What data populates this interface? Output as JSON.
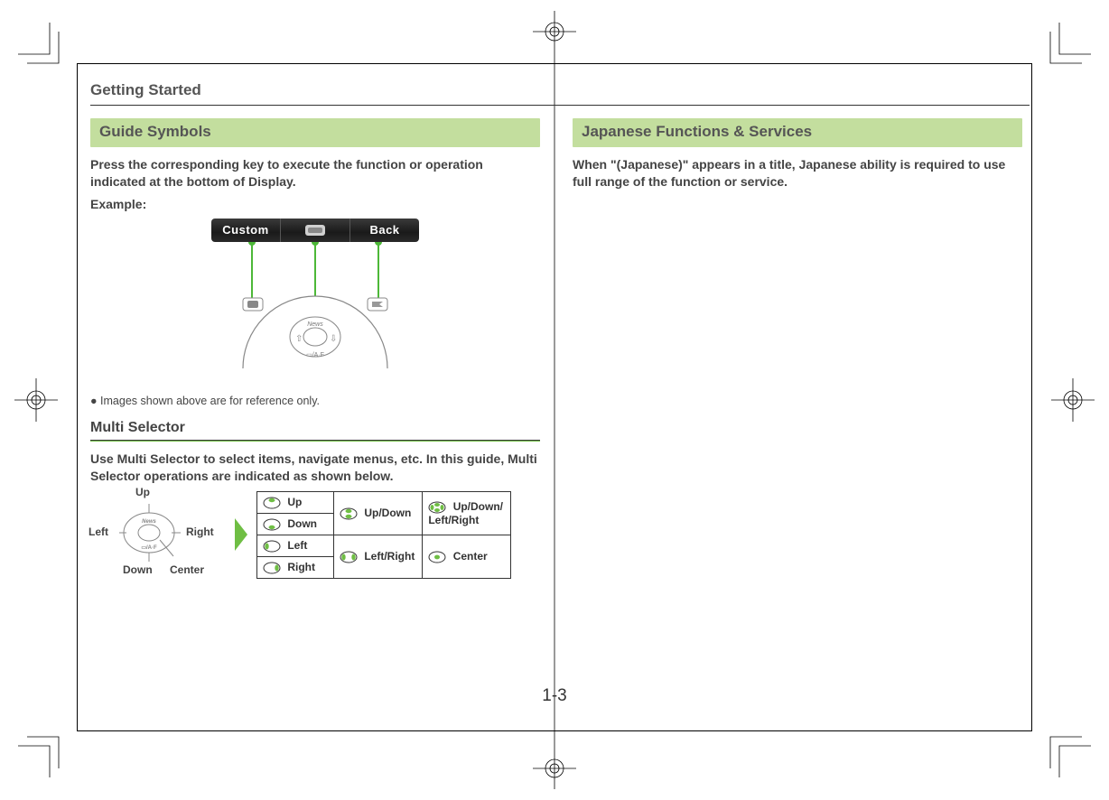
{
  "header": "Getting Started",
  "page_number": "1-3",
  "left": {
    "section1_title": "Guide Symbols",
    "intro1": "Press the corresponding key to execute the function or operation indicated at the bottom of Display.",
    "intro2": "Example:",
    "softkeys": {
      "left": "Custom",
      "right": "Back",
      "center_icon": "info-icon"
    },
    "note": "Images shown above are for reference only.",
    "subhead": "Multi Selector",
    "ms_desc": "Use Multi Selector to select items, navigate menus, etc. In this guide, Multi Selector operations are indicated as shown below.",
    "labels": {
      "up": "Up",
      "down": "Down",
      "left": "Left",
      "right": "Right",
      "center": "Center"
    },
    "table": {
      "r1c1": "Up",
      "r1c2": "Up/Down",
      "r1c3_line1": "Up/Down/",
      "r1c3_line2": "Left/Right",
      "r2c1": "Down",
      "r3c1": "Left",
      "r3c2": "Left/Right",
      "r3c3": "Center",
      "r4c1": "Right"
    }
  },
  "right": {
    "section_title": "Japanese Functions & Services",
    "body": "When \"(Japanese)\" appears in a title, Japanese ability is required to use full range of the function or service."
  }
}
